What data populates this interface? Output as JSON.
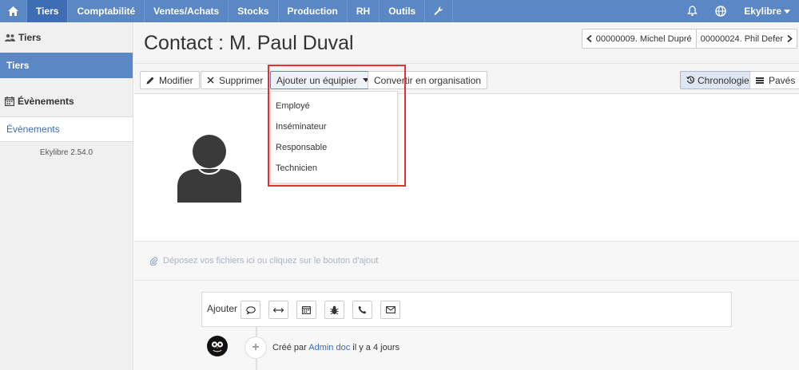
{
  "nav": {
    "items": [
      "Tiers",
      "Comptabilité",
      "Ventes/Achats",
      "Stocks",
      "Production",
      "RH",
      "Outils"
    ],
    "user": "Ekylibre"
  },
  "sidebar": {
    "section1": "Tiers",
    "link1": "Tiers",
    "section2": "Évènements",
    "link2": "Évènements",
    "version": "Ekylibre 2.54.0"
  },
  "page": {
    "title": "Contact : M. Paul Duval",
    "prev": "00000009. Michel Dupré",
    "next": "00000024. Phil Defer"
  },
  "toolbar": {
    "edit": "Modifier",
    "delete": "Supprimer",
    "add_equipment": "Ajouter un équipier",
    "convert": "Convertir en organisation",
    "timeline": "Chronologie",
    "tiles": "Pavés"
  },
  "dropdown": [
    "Employé",
    "Inséminateur",
    "Responsable",
    "Technicien"
  ],
  "dropzone": "Déposez vos fichiers ici ou cliquez sur le bouton d'ajout",
  "timeline": {
    "add_label": "Ajouter",
    "created_prefix": "Créé par",
    "author": "Admin doc",
    "created_suffix": "il y a 4 jours"
  },
  "colors": {
    "nav": "#5b87c5",
    "nav_active": "#3d6db3",
    "highlight": "#e53030",
    "link": "#3a6cb5"
  }
}
